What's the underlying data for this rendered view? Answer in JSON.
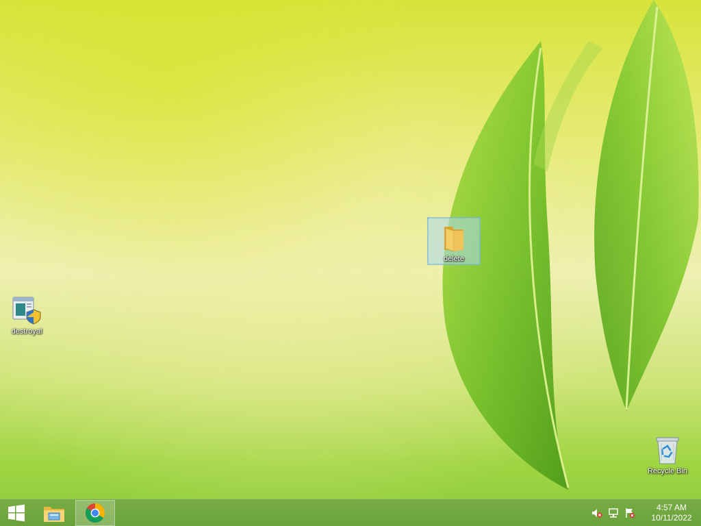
{
  "desktop": {
    "icons": [
      {
        "label": "destroyal",
        "icon": "installer-shield-icon"
      },
      {
        "label": "delete",
        "icon": "folder-icon",
        "selected": true
      },
      {
        "label": "Recycle Bin",
        "icon": "recycle-bin-icon"
      }
    ]
  },
  "taskbar": {
    "start_icon": "windows-logo-icon",
    "pinned": [
      {
        "name": "File Explorer",
        "icon": "file-explorer-icon"
      },
      {
        "name": "Google Chrome",
        "icon": "chrome-icon",
        "active": true
      }
    ],
    "tray": {
      "icons": [
        "volume-muted-icon",
        "network-icon",
        "action-center-flag-icon"
      ],
      "time": "4:57 AM",
      "date": "10/11/2022"
    }
  },
  "colors": {
    "taskbar": "#6aa13a",
    "wallpaper_top": "#d7e43a",
    "wallpaper_bottom": "#8ccc3a",
    "leaf": "#7fc62f",
    "selection": "#aad7f0"
  }
}
